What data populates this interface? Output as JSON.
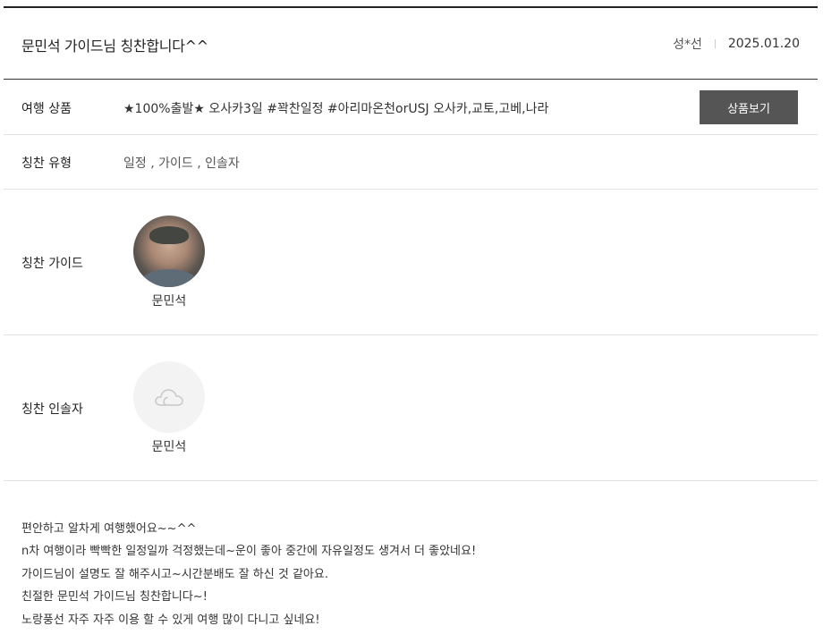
{
  "header": {
    "title": "문민석 가이드님 칭찬합니다^^",
    "author": "성*선",
    "date": "2025.01.20"
  },
  "product": {
    "label": "여행 상품",
    "value": "★100%출발★ 오사카3일 #꽉찬일정 #아리마온천orUSJ 오사카,교토,고베,나라",
    "button_label": "상품보기"
  },
  "praise_type": {
    "label": "칭찬 유형",
    "value": "일정 , 가이드 , 인솔자"
  },
  "praise_guide": {
    "label": "칭찬 가이드",
    "name": "문민석"
  },
  "praise_escort": {
    "label": "칭찬 인솔자",
    "name": "문민석",
    "icon": "cloud-icon"
  },
  "content": {
    "lines": [
      "편안하고 알차게 여행했어요~~^^",
      "n차 여행이라 빡빡한 일정일까 걱정했는데~운이 좋아 중간에 자유일정도 생겨서 더 좋았네요!",
      "가이드님이 설명도 잘 해주시고~시간분배도 잘 하신 것 같아요.",
      "친절한 문민석 가이드님 칭찬합니다~!",
      "노랑풍선 자주 자주 이용 할 수 있게 여행 많이 다니고 싶네요!"
    ]
  }
}
